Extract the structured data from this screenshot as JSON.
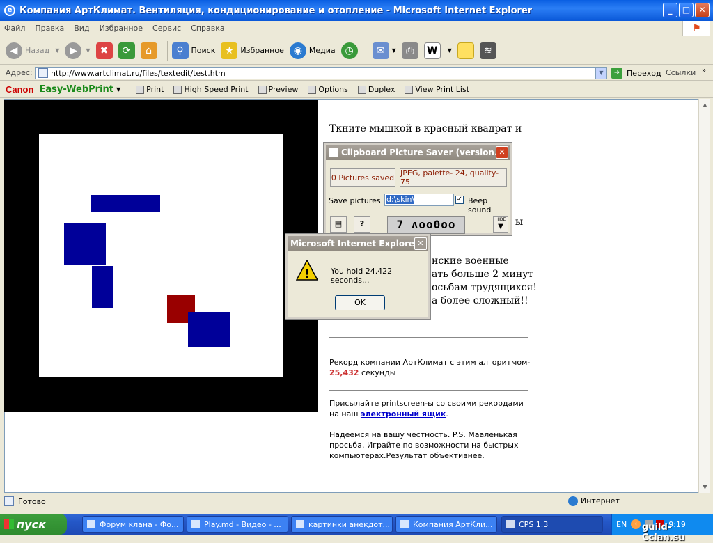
{
  "window": {
    "title": "Компания АртКлимат. Вентиляция, кондиционирование и отопление - Microsoft Internet Explorer",
    "minimize": "_",
    "maximize": "□",
    "close": "✕"
  },
  "menu": [
    "Файл",
    "Правка",
    "Вид",
    "Избранное",
    "Сервис",
    "Справка"
  ],
  "toolbar": {
    "back": "Назад",
    "search": "Поиск",
    "favorites": "Избранное",
    "media": "Медиа"
  },
  "address": {
    "label": "Адрес:",
    "url": "http://www.artclimat.ru/files/textedit/test.htm",
    "go": "Переход",
    "links": "Ссылки"
  },
  "canon": {
    "brand": "Canon",
    "product": "Easy-WebPrint",
    "print": "Print",
    "high_speed": "High Speed Print",
    "preview": "Preview",
    "options": "Options",
    "duplex": "Duplex",
    "view_list": "View Print List"
  },
  "page": {
    "intro_line1": "Ткните мышкой в красный квадрат и",
    "partial_right": "ы",
    "mil_line1": "нские военные",
    "mil_line2": "ать больше 2 минут",
    "mil_line3": "осьбам трудящихся!",
    "mil_line4": "а более сложный!!",
    "record_label": "Рекорд компании АртКлимат с этим алгоритмом-",
    "record_value": "25,432",
    "record_unit": " секунды",
    "send_text": "Присылайте printscreen-ы со своими рекордами на наш ",
    "email_link": "электронный ящик",
    "period": ".",
    "honesty": "Надеемся на вашу честность. P.S. Мааленькая просьба. Играйте по возможности на быстрых компьютерах.Результат объективнее."
  },
  "cps": {
    "title": "Clipboard Picture Saver (version...",
    "pictures_saved": "0 Pictures saved",
    "format": "JPEG, palette- 24, quality- 75",
    "save_label": "Save pictures in",
    "path": "d:\\skin\\",
    "beep": "Beep sound",
    "counter": "7 ʌoo0oo",
    "hide": "HIDE",
    "help": "?"
  },
  "alert": {
    "title": "Microsoft Internet Explorer",
    "message": "You hold 24.422 seconds...",
    "ok": "OK",
    "icon": "!"
  },
  "status": {
    "ready": "Готово",
    "zone": "Интернет"
  },
  "taskbar": {
    "start": "пуск",
    "tasks": [
      "Форум клана - Фо...",
      "Play.md - Видео - ...",
      "картинки анекдот...",
      "Компания АртКли...",
      "CPS 1.3"
    ],
    "lang": "EN",
    "clock": "9:19",
    "watermark": "guild-Cclan.su"
  },
  "colors": {
    "title_blue": "#0a5fe2",
    "square_blue": "#000099",
    "square_red": "#990000",
    "record_red": "#cc3333",
    "link_blue": "#0000cc"
  }
}
